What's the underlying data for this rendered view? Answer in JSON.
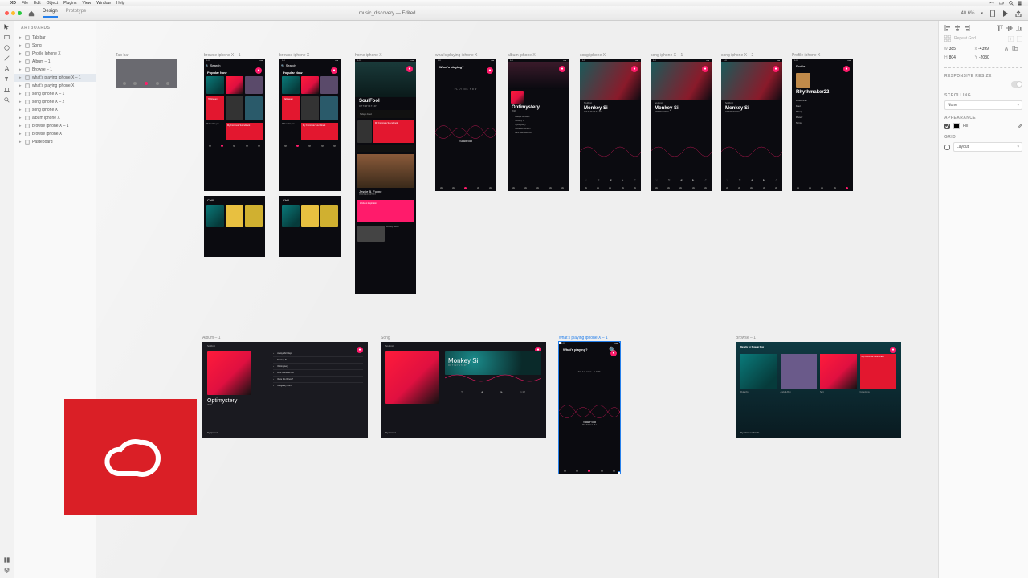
{
  "menubar": {
    "app": "XD",
    "items": [
      "File",
      "Edit",
      "Object",
      "Plugins",
      "View",
      "Window",
      "Help"
    ]
  },
  "toolbar": {
    "tabs": {
      "design": "Design",
      "prototype": "Prototype"
    },
    "doc": "music_discovery — Edited",
    "zoom": "40.6%"
  },
  "layers": {
    "header": "ARTBOARDS",
    "items": [
      {
        "label": "Tab bar"
      },
      {
        "label": "Song"
      },
      {
        "label": "Profile Iphone X"
      },
      {
        "label": "Album – 1"
      },
      {
        "label": "Browse – 1"
      },
      {
        "label": "what's playing iphone X – 1",
        "selected": true
      },
      {
        "label": "what's playing iphone X"
      },
      {
        "label": "song iphone X – 1"
      },
      {
        "label": "song iphone X – 2"
      },
      {
        "label": "song iphone X"
      },
      {
        "label": "album iphone X"
      },
      {
        "label": "browse iphone X – 1"
      },
      {
        "label": "browse iphone X"
      },
      {
        "label": "Pasteboard"
      }
    ]
  },
  "artboards": {
    "tabbar": {
      "label": "Tab bar"
    },
    "browse1": {
      "label": "browse iphone X – 1",
      "search": "Search",
      "h1": "Popular Now",
      "chip": "Halloween",
      "card": "My Commute Soundtrack",
      "picked": "Picked for you",
      "chill": "Chill"
    },
    "browse2": {
      "label": "browse iphone X",
      "search": "Search",
      "h1": "Popular Now",
      "chip": "Halloween",
      "card": "My Commute Soundtrack",
      "picked": "Picked for you",
      "chill": "Chill"
    },
    "home": {
      "label": "home iphone X",
      "title": "SoulFool",
      "sub": "OPTIMYSTERY",
      "feed": "Today's Feed",
      "card": "My Commute Soundtrack",
      "artist": "Jessie B. Foyne",
      "workout": "Workout Inspiration",
      "weekly": "Weekly Album"
    },
    "playing": {
      "label": "what's playing iphone X",
      "header": "What's playing?",
      "now": "PLAYING NOW",
      "track": "SoulFool"
    },
    "album": {
      "label": "album iphone X",
      "title": "Optimystery",
      "year": "2019",
      "tracks": [
        "Always All Ways",
        "Monkey Si",
        "Optimystery",
        "Were We Where?",
        "Best Guessed List"
      ]
    },
    "song": {
      "label": "song iphone X",
      "artist": "SoulFool",
      "title": "Monkey Si",
      "sub": "OPTIMYSTERY"
    },
    "song1": {
      "label": "song iphone X – 1",
      "artist": "SoulFool",
      "title": "Monkey Si",
      "sub": "OPTIMYSTERY"
    },
    "song2": {
      "label": "song iphone X – 2",
      "artist": "SoulFool",
      "title": "Monkey Si",
      "sub": "OPTIMYSTERY"
    },
    "profile": {
      "label": "Profile iphone X",
      "header": "Profile",
      "name": "Rhythmaker22",
      "menu": [
        "Preferences",
        "Feed",
        "History",
        "Privacy",
        "Terms"
      ]
    },
    "albumBig": {
      "label": "Album – 1",
      "artist": "SoulFool",
      "title": "Optimystery",
      "year": "2019",
      "tracks": [
        "Always All Ways",
        "Monkey Si",
        "Optimystery",
        "Best Guessed List",
        "Were We Where?",
        "Obligatory Horns"
      ],
      "hint": "Try \"pause\""
    },
    "songBig": {
      "label": "Song",
      "artist": "SoulFool",
      "title": "Monkey Si",
      "sub": "OPTIMYSTERY",
      "time": "1:28",
      "hint": "Try \"pause\""
    },
    "playingSel": {
      "label": "what's playing iphone X – 1",
      "header": "What's playing?",
      "now": "PLAYING NOW",
      "track": "SoulFool",
      "sub": "MONKEY SI"
    },
    "browseBig": {
      "label": "Browse – 1",
      "header": "Results for Popular Now",
      "cards": [
        "Flutterby",
        "Andy & Ben",
        "Sort",
        "My Commute Soundtrack"
      ],
      "coll": "Collections",
      "hint": "Try \"show number 1\""
    }
  },
  "inspector": {
    "repeat": "Repeat Grid",
    "w": "385",
    "x": "-4399",
    "h": "804",
    "y": "-2030",
    "responsive": "RESPONSIVE RESIZE",
    "scrolling": "SCROLLING",
    "scrollVal": "None",
    "appearance": "APPEARANCE",
    "fill": "Fill",
    "grid": "GRID",
    "layout": "Layout"
  }
}
